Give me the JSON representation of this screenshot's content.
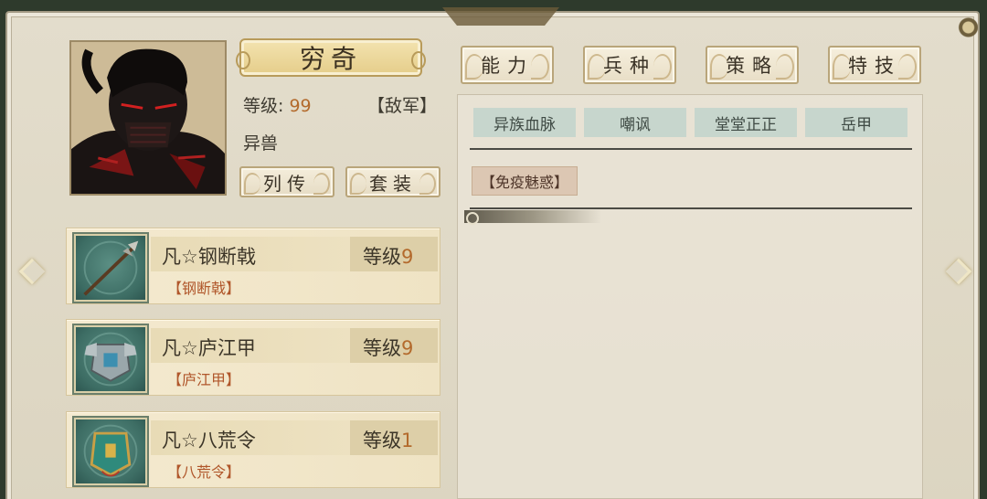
{
  "character": {
    "name": "穷奇",
    "level_label": "等级:",
    "level_value": "99",
    "faction": "【敌军】",
    "type": "异兽",
    "portrait_icon": "masked-warrior-portrait"
  },
  "buttons": {
    "biography": "列传",
    "outfit": "套装"
  },
  "tabs": [
    {
      "label": "能力"
    },
    {
      "label": "兵种"
    },
    {
      "label": "策略"
    },
    {
      "label": "特技"
    }
  ],
  "skills": [
    "异族血脉",
    "嘲讽",
    "堂堂正正",
    "岳甲"
  ],
  "traits": [
    "【免疫魅惑】"
  ],
  "equipment": [
    {
      "name": "凡☆钢断戟",
      "level_label": "等级",
      "level": "9",
      "sub": "【钢断戟】",
      "icon": "halberd-icon"
    },
    {
      "name": "凡☆庐江甲",
      "level_label": "等级",
      "level": "9",
      "sub": "【庐江甲】",
      "icon": "armor-icon"
    },
    {
      "name": "凡☆八荒令",
      "level_label": "等级",
      "level": "1",
      "sub": "【八荒令】",
      "icon": "token-icon"
    }
  ],
  "colors": {
    "accent_value": "#b36a2c",
    "panel_bg": "#dcd5c1",
    "skill_chip": "#c7d6cd",
    "trait_chip": "#dcc7b3"
  }
}
